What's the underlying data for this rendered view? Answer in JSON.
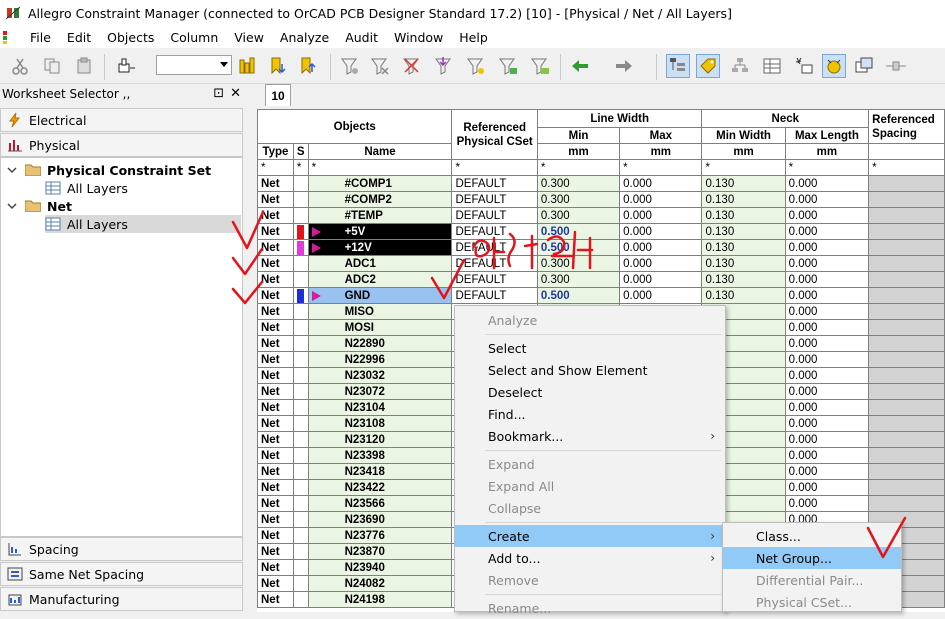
{
  "window": {
    "title": "Allegro Constraint Manager (connected to OrCAD PCB Designer Standard 17.2) [10] - [Physical / Net / All Layers]"
  },
  "menu": [
    "File",
    "Edit",
    "Objects",
    "Column",
    "View",
    "Analyze",
    "Audit",
    "Window",
    "Help"
  ],
  "worksheet_selector": {
    "title": "Worksheet Selector ,,",
    "pin_icon": "⊡",
    "close_icon": "✕",
    "categories_top": [
      "Electrical",
      "Physical"
    ],
    "tree": [
      {
        "label": "Physical Constraint Set",
        "level": 0
      },
      {
        "label": "All Layers",
        "level": 1
      },
      {
        "label": "Net",
        "level": 0
      },
      {
        "label": "All Layers",
        "level": 1,
        "selected": true
      }
    ],
    "categories_bottom": [
      "Spacing",
      "Same Net Spacing",
      "Manufacturing"
    ]
  },
  "tab": {
    "label": "10"
  },
  "grid": {
    "headers": {
      "objects": "Objects",
      "ref_cset": "Referenced Physical CSet",
      "line_width": "Line Width",
      "neck": "Neck",
      "ref_spacing": "Referenced Spacing",
      "type": "Type",
      "s": "S",
      "name": "Name",
      "min": "Min",
      "max": "Max",
      "min_width": "Min Width",
      "max_length": "Max Length",
      "unit": "mm"
    },
    "filter": {
      "star": "*"
    },
    "rows": [
      {
        "type": "Net",
        "name": "#COMP1",
        "cset": "DEFAULT",
        "min": "0.300",
        "max": "0.000",
        "neck_min": "0.130",
        "neck_max": "0.000"
      },
      {
        "type": "Net",
        "name": "#COMP2",
        "cset": "DEFAULT",
        "min": "0.300",
        "max": "0.000",
        "neck_min": "0.130",
        "neck_max": "0.000"
      },
      {
        "type": "Net",
        "name": "#TEMP",
        "cset": "DEFAULT",
        "min": "0.300",
        "max": "0.000",
        "neck_min": "0.130",
        "neck_max": "0.000"
      },
      {
        "type": "Net",
        "name": "+5V",
        "cset": "DEFAULT",
        "min": "0.500",
        "max": "0.000",
        "neck_min": "0.130",
        "neck_max": "0.000",
        "swatch": "#e0141a",
        "dark": true
      },
      {
        "type": "Net",
        "name": "+12V",
        "cset": "DEFAULT",
        "min": "0.500",
        "max": "0.000",
        "neck_min": "0.130",
        "neck_max": "0.000",
        "swatch": "#e03ad8",
        "dark": true
      },
      {
        "type": "Net",
        "name": "ADC1",
        "cset": "DEFAULT",
        "min": "0.300",
        "max": "0.000",
        "neck_min": "0.130",
        "neck_max": "0.000"
      },
      {
        "type": "Net",
        "name": "ADC2",
        "cset": "DEFAULT",
        "min": "0.300",
        "max": "0.000",
        "neck_min": "0.130",
        "neck_max": "0.000"
      },
      {
        "type": "Net",
        "name": "GND",
        "cset": "DEFAULT",
        "min": "0.500",
        "max": "0.000",
        "neck_min": "0.130",
        "neck_max": "0.000",
        "swatch": "#1c2fd6",
        "selected": true
      },
      {
        "type": "Net",
        "name": "MISO",
        "neck_min": "130",
        "neck_max": "0.000"
      },
      {
        "type": "Net",
        "name": "MOSI",
        "neck_min": "130",
        "neck_max": "0.000"
      },
      {
        "type": "Net",
        "name": "N22890",
        "neck_min": "130",
        "neck_max": "0.000"
      },
      {
        "type": "Net",
        "name": "N22996",
        "neck_min": "130",
        "neck_max": "0.000"
      },
      {
        "type": "Net",
        "name": "N23032",
        "neck_min": "130",
        "neck_max": "0.000"
      },
      {
        "type": "Net",
        "name": "N23072",
        "neck_min": "130",
        "neck_max": "0.000"
      },
      {
        "type": "Net",
        "name": "N23104",
        "neck_min": "130",
        "neck_max": "0.000"
      },
      {
        "type": "Net",
        "name": "N23108",
        "neck_min": "130",
        "neck_max": "0.000"
      },
      {
        "type": "Net",
        "name": "N23120",
        "neck_min": "130",
        "neck_max": "0.000"
      },
      {
        "type": "Net",
        "name": "N23398",
        "neck_min": "130",
        "neck_max": "0.000"
      },
      {
        "type": "Net",
        "name": "N23418",
        "neck_min": "130",
        "neck_max": "0.000"
      },
      {
        "type": "Net",
        "name": "N23422",
        "neck_min": "130",
        "neck_max": "0.000"
      },
      {
        "type": "Net",
        "name": "N23566",
        "neck_min": "130",
        "neck_max": "0.000"
      },
      {
        "type": "Net",
        "name": "N23690",
        "neck_min": "130",
        "neck_max": "0.000"
      },
      {
        "type": "Net",
        "name": "N23776",
        "neck_min": "130",
        "neck_max": "0.000"
      },
      {
        "type": "Net",
        "name": "N23870",
        "neck_min": "",
        "neck_max": ""
      },
      {
        "type": "Net",
        "name": "N23940",
        "neck_min": "",
        "neck_max": ""
      },
      {
        "type": "Net",
        "name": "N24082",
        "neck_min": "",
        "neck_max": ""
      },
      {
        "type": "Net",
        "name": "N24198",
        "neck_min": "",
        "neck_max": ""
      }
    ]
  },
  "context_menu": {
    "items": [
      {
        "label": "Analyze",
        "disabled": true
      },
      {
        "sep": true
      },
      {
        "label": "Select"
      },
      {
        "label": "Select and Show Element"
      },
      {
        "label": "Deselect"
      },
      {
        "label": "Find..."
      },
      {
        "label": "Bookmark...",
        "submenu": true
      },
      {
        "sep": true
      },
      {
        "label": "Expand",
        "disabled": true
      },
      {
        "label": "Expand All",
        "disabled": true
      },
      {
        "label": "Collapse",
        "disabled": true
      },
      {
        "sep": true
      },
      {
        "label": "Create",
        "submenu": true,
        "highlight": true
      },
      {
        "label": "Add to...",
        "submenu": true
      },
      {
        "label": "Remove",
        "disabled": true
      },
      {
        "sep": true
      },
      {
        "label": "Rename...",
        "disabled": true
      }
    ],
    "create_submenu": [
      {
        "label": "Class..."
      },
      {
        "label": "Net Group...",
        "highlight": true
      },
      {
        "label": "Differential Pair...",
        "disabled": true
      },
      {
        "label": "Physical CSet...",
        "disabled": true
      }
    ]
  },
  "colors": {
    "accent_highlight": "#91c9f7",
    "row_green": "#eaf6e3",
    "annotation_red": "#e3141b"
  }
}
